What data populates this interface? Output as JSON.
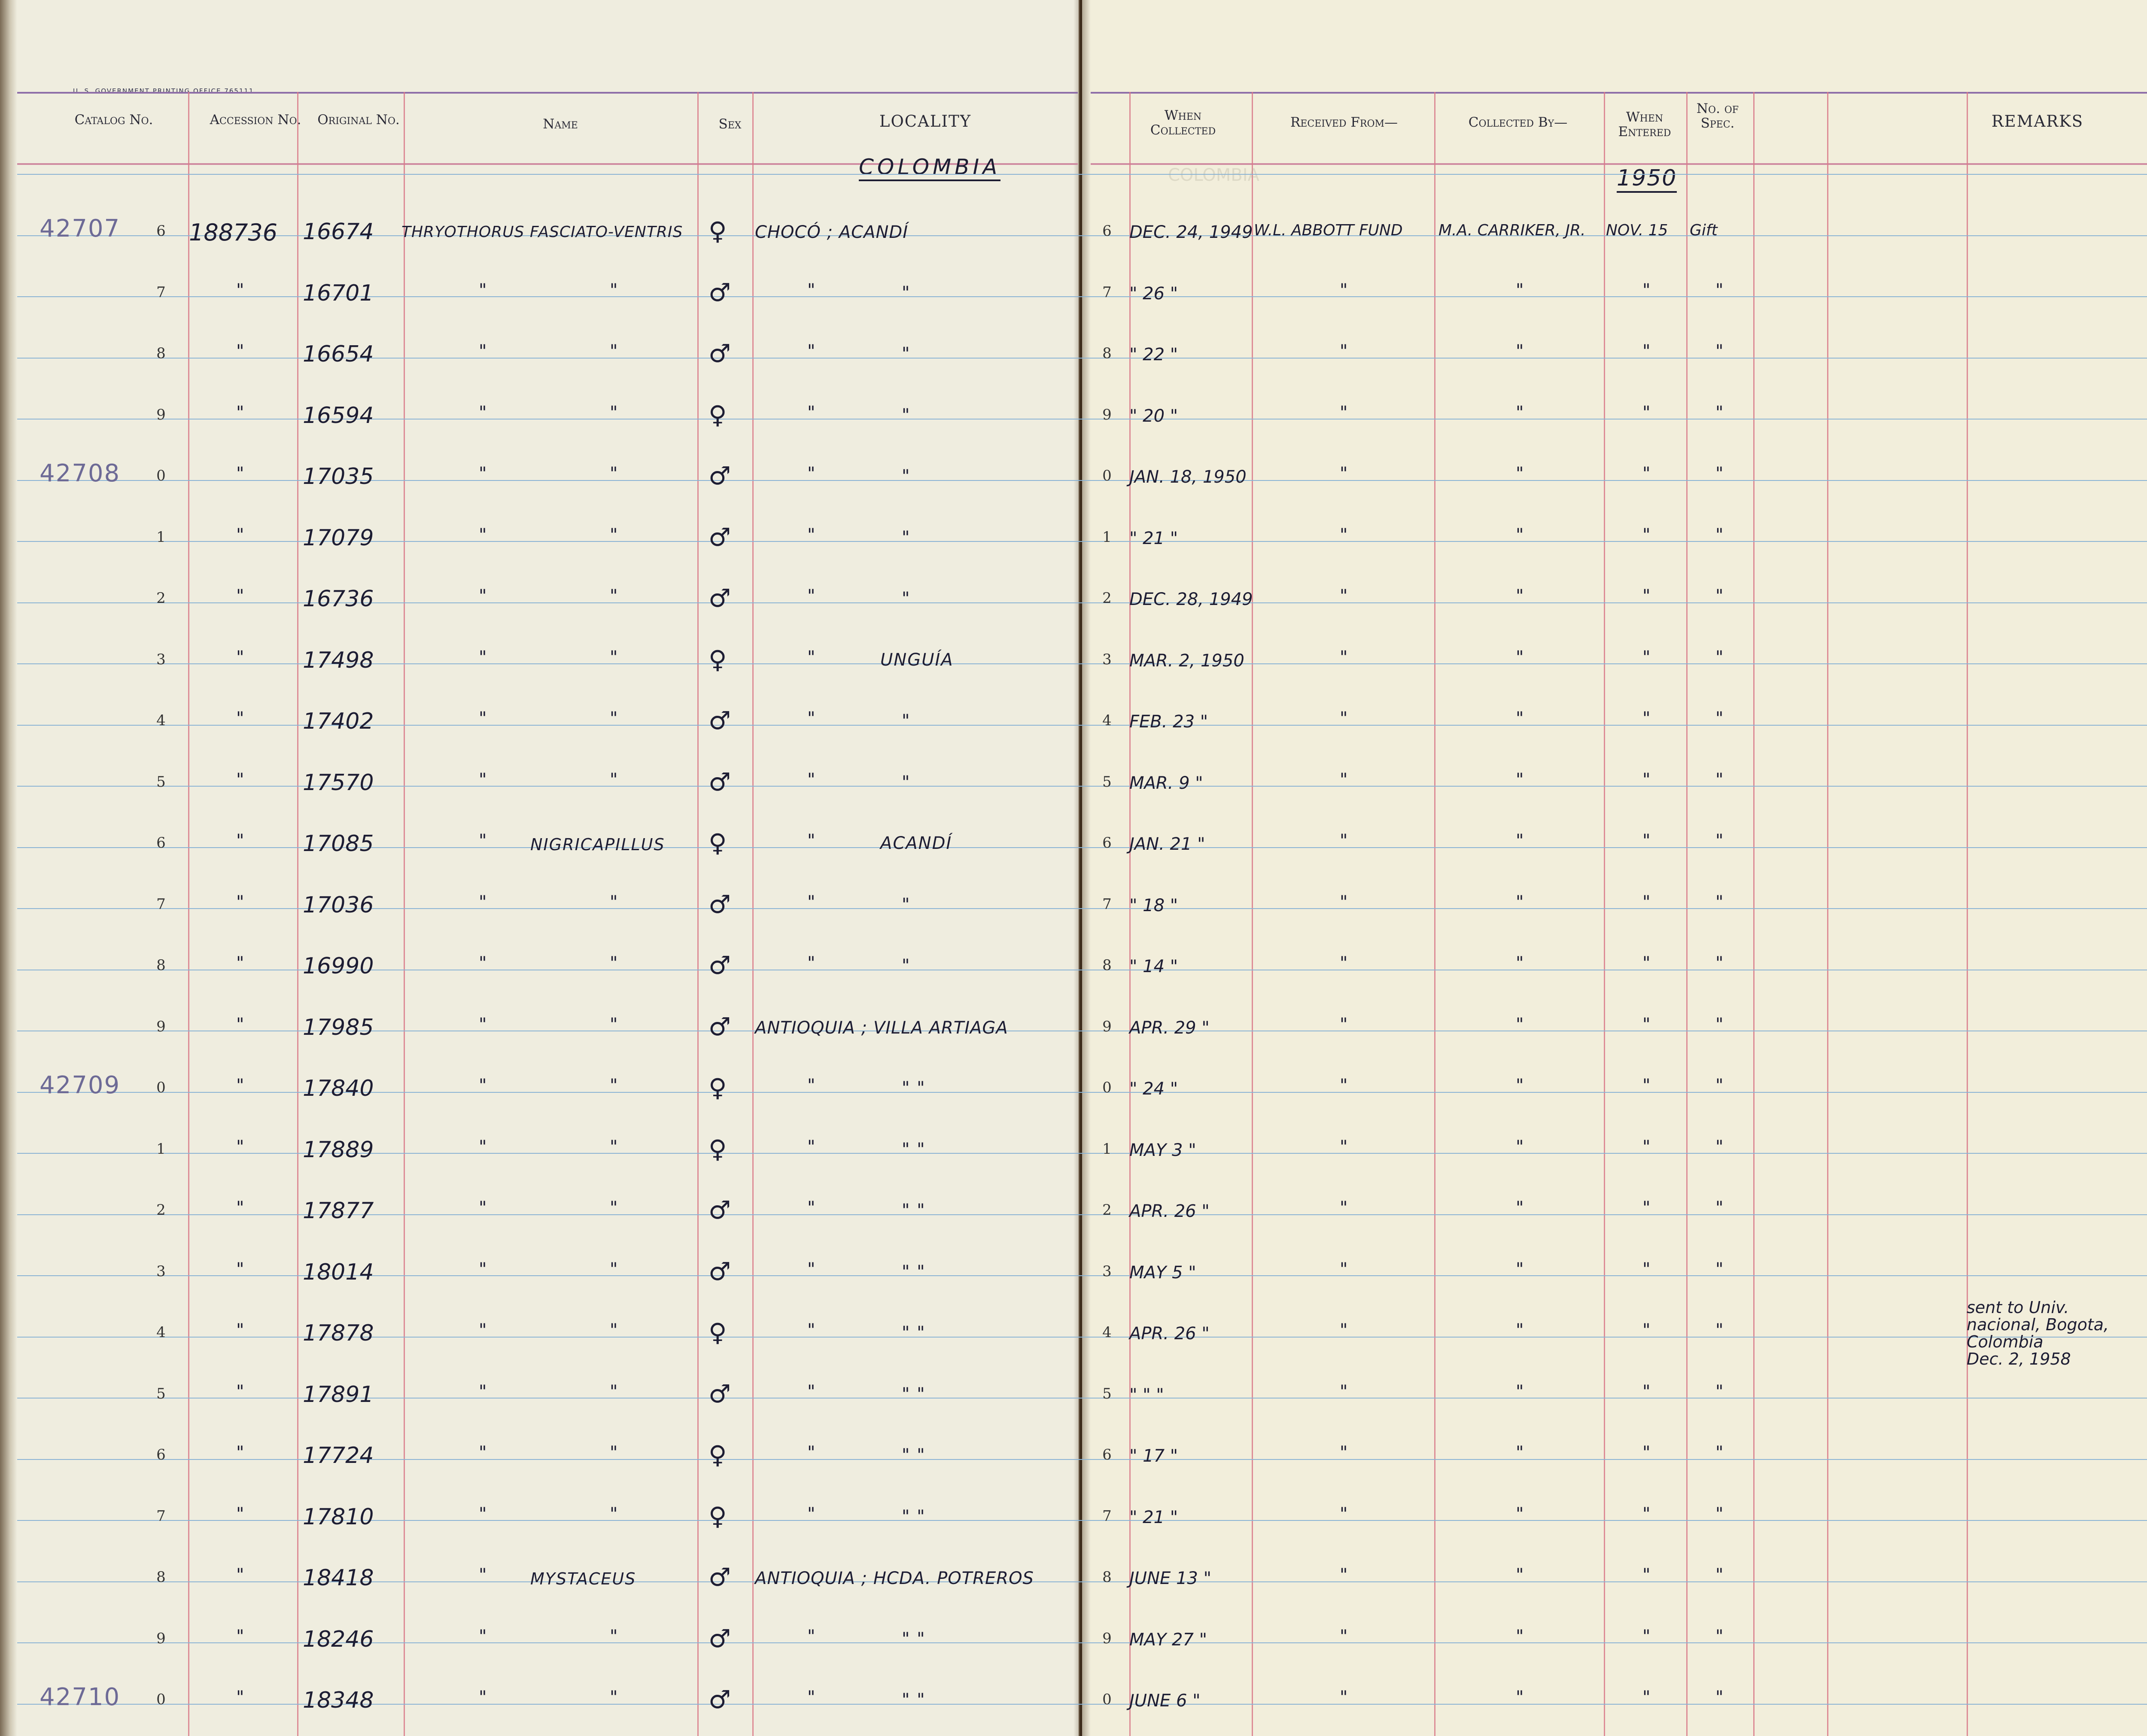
{
  "printer_imprint": "U. S. GOVERNMENT PRINTING OFFICE  765111",
  "headers": {
    "catalog": "Catalog No.",
    "accession": "Accession No.",
    "original": "Original No.",
    "name": "Name",
    "sex": "Sex",
    "locality": "LOCALITY",
    "when_collected": "When Collected",
    "received_from": "Received From—",
    "collected_by": "Collected By—",
    "when_entered": "When Entered",
    "no_spec": "No. of Spec.",
    "remarks": "REMARKS"
  },
  "country_heading": "COLOMBIA",
  "year_heading": "1950",
  "catalog_prefixes": [
    {
      "row": 0,
      "text": "42707"
    },
    {
      "row": 4,
      "text": "42708"
    },
    {
      "row": 14,
      "text": "42709"
    },
    {
      "row": 24,
      "text": "42710"
    }
  ],
  "rows": [
    {
      "num": "6",
      "accession": "188736",
      "original": "16674",
      "name1": "THRYOTHORUS FASCIATO-VENTRIS",
      "name2": "",
      "sex": "♀",
      "loc1": "CHOCÓ ; ACANDÍ",
      "loc2": "",
      "date": "DEC. 24, 1949",
      "recv": "W.L. ABBOTT FUND",
      "coll": "M.A. CARRIKER, JR.",
      "entered": "NOV. 15",
      "spec": "Gift"
    },
    {
      "num": "7",
      "accession": "\"",
      "original": "16701",
      "name1": "\"",
      "name2": "\"",
      "sex": "♂",
      "loc1": "\"",
      "loc2": "\"",
      "date": "\" 26 \"",
      "recv": "\"",
      "coll": "\"",
      "entered": "\"",
      "spec": "\""
    },
    {
      "num": "8",
      "accession": "\"",
      "original": "16654",
      "name1": "\"",
      "name2": "\"",
      "sex": "♂",
      "loc1": "\"",
      "loc2": "\"",
      "date": "\" 22 \"",
      "recv": "\"",
      "coll": "\"",
      "entered": "\"",
      "spec": "\""
    },
    {
      "num": "9",
      "accession": "\"",
      "original": "16594",
      "name1": "\"",
      "name2": "\"",
      "sex": "♀",
      "loc1": "\"",
      "loc2": "\"",
      "date": "\" 20 \"",
      "recv": "\"",
      "coll": "\"",
      "entered": "\"",
      "spec": "\""
    },
    {
      "num": "0",
      "accession": "\"",
      "original": "17035",
      "name1": "\"",
      "name2": "\"",
      "sex": "♂",
      "loc1": "\"",
      "loc2": "\"",
      "date": "JAN. 18, 1950",
      "recv": "\"",
      "coll": "\"",
      "entered": "\"",
      "spec": "\""
    },
    {
      "num": "1",
      "accession": "\"",
      "original": "17079",
      "name1": "\"",
      "name2": "\"",
      "sex": "♂",
      "loc1": "\"",
      "loc2": "\"",
      "date": "\" 21 \"",
      "recv": "\"",
      "coll": "\"",
      "entered": "\"",
      "spec": "\""
    },
    {
      "num": "2",
      "accession": "\"",
      "original": "16736",
      "name1": "\"",
      "name2": "\"",
      "sex": "♂",
      "loc1": "\"",
      "loc2": "\"",
      "date": "DEC. 28, 1949",
      "recv": "\"",
      "coll": "\"",
      "entered": "\"",
      "spec": "\""
    },
    {
      "num": "3",
      "accession": "\"",
      "original": "17498",
      "name1": "\"",
      "name2": "\"",
      "sex": "♀",
      "loc1": "\"",
      "loc2": "UNGUÍA",
      "date": "MAR. 2, 1950",
      "recv": "\"",
      "coll": "\"",
      "entered": "\"",
      "spec": "\""
    },
    {
      "num": "4",
      "accession": "\"",
      "original": "17402",
      "name1": "\"",
      "name2": "\"",
      "sex": "♂",
      "loc1": "\"",
      "loc2": "\"",
      "date": "FEB. 23 \"",
      "recv": "\"",
      "coll": "\"",
      "entered": "\"",
      "spec": "\""
    },
    {
      "num": "5",
      "accession": "\"",
      "original": "17570",
      "name1": "\"",
      "name2": "\"",
      "sex": "♂",
      "loc1": "\"",
      "loc2": "\"",
      "date": "MAR. 9 \"",
      "recv": "\"",
      "coll": "\"",
      "entered": "\"",
      "spec": "\""
    },
    {
      "num": "6",
      "accession": "\"",
      "original": "17085",
      "name1": "\"",
      "name2": "NIGRICAPILLUS",
      "sex": "♀",
      "loc1": "\"",
      "loc2": "ACANDÍ",
      "date": "JAN. 21 \"",
      "recv": "\"",
      "coll": "\"",
      "entered": "\"",
      "spec": "\""
    },
    {
      "num": "7",
      "accession": "\"",
      "original": "17036",
      "name1": "\"",
      "name2": "\"",
      "sex": "♂",
      "loc1": "\"",
      "loc2": "\"",
      "date": "\" 18 \"",
      "recv": "\"",
      "coll": "\"",
      "entered": "\"",
      "spec": "\""
    },
    {
      "num": "8",
      "accession": "\"",
      "original": "16990",
      "name1": "\"",
      "name2": "\"",
      "sex": "♂",
      "loc1": "\"",
      "loc2": "\"",
      "date": "\" 14 \"",
      "recv": "\"",
      "coll": "\"",
      "entered": "\"",
      "spec": "\""
    },
    {
      "num": "9",
      "accession": "\"",
      "original": "17985",
      "name1": "\"",
      "name2": "\"",
      "sex": "♂",
      "loc1": "ANTIOQUIA ; VILLA ARTIAGA",
      "loc2": "",
      "date": "APR. 29 \"",
      "recv": "\"",
      "coll": "\"",
      "entered": "\"",
      "spec": "\""
    },
    {
      "num": "0",
      "accession": "\"",
      "original": "17840",
      "name1": "\"",
      "name2": "\"",
      "sex": "♀",
      "loc1": "\"",
      "loc2": "\"  \"",
      "date": "\" 24 \"",
      "recv": "\"",
      "coll": "\"",
      "entered": "\"",
      "spec": "\""
    },
    {
      "num": "1",
      "accession": "\"",
      "original": "17889",
      "name1": "\"",
      "name2": "\"",
      "sex": "♀",
      "loc1": "\"",
      "loc2": "\"  \"",
      "date": "MAY 3 \"",
      "recv": "\"",
      "coll": "\"",
      "entered": "\"",
      "spec": "\""
    },
    {
      "num": "2",
      "accession": "\"",
      "original": "17877",
      "name1": "\"",
      "name2": "\"",
      "sex": "♂",
      "loc1": "\"",
      "loc2": "\"  \"",
      "date": "APR. 26 \"",
      "recv": "\"",
      "coll": "\"",
      "entered": "\"",
      "spec": "\""
    },
    {
      "num": "3",
      "accession": "\"",
      "original": "18014",
      "name1": "\"",
      "name2": "\"",
      "sex": "♂",
      "loc1": "\"",
      "loc2": "\"  \"",
      "date": "MAY 5 \"",
      "recv": "\"",
      "coll": "\"",
      "entered": "\"",
      "spec": "\""
    },
    {
      "num": "4",
      "accession": "\"",
      "original": "17878",
      "name1": "\"",
      "name2": "\"",
      "sex": "♀",
      "loc1": "\"",
      "loc2": "\"  \"",
      "date": "APR. 26 \"",
      "recv": "\"",
      "coll": "\"",
      "entered": "\"",
      "spec": "\""
    },
    {
      "num": "5",
      "accession": "\"",
      "original": "17891",
      "name1": "\"",
      "name2": "\"",
      "sex": "♂",
      "loc1": "\"",
      "loc2": "\"  \"",
      "date": "\" \" \"",
      "recv": "\"",
      "coll": "\"",
      "entered": "\"",
      "spec": "\""
    },
    {
      "num": "6",
      "accession": "\"",
      "original": "17724",
      "name1": "\"",
      "name2": "\"",
      "sex": "♀",
      "loc1": "\"",
      "loc2": "\"  \"",
      "date": "\" 17 \"",
      "recv": "\"",
      "coll": "\"",
      "entered": "\"",
      "spec": "\""
    },
    {
      "num": "7",
      "accession": "\"",
      "original": "17810",
      "name1": "\"",
      "name2": "\"",
      "sex": "♀",
      "loc1": "\"",
      "loc2": "\"  \"",
      "date": "\" 21 \"",
      "recv": "\"",
      "coll": "\"",
      "entered": "\"",
      "spec": "\""
    },
    {
      "num": "8",
      "accession": "\"",
      "original": "18418",
      "name1": "\"",
      "name2": "MYSTACEUS",
      "sex": "♂",
      "loc1": "ANTIOQUIA ; HCDA. POTREROS",
      "loc2": "",
      "date": "JUNE 13 \"",
      "recv": "\"",
      "coll": "\"",
      "entered": "\"",
      "spec": "\""
    },
    {
      "num": "9",
      "accession": "\"",
      "original": "18246",
      "name1": "\"",
      "name2": "\"",
      "sex": "♂",
      "loc1": "\"",
      "loc2": "\"  \"",
      "date": "MAY 27 \"",
      "recv": "\"",
      "coll": "\"",
      "entered": "\"",
      "spec": "\""
    },
    {
      "num": "0",
      "accession": "\"",
      "original": "18348",
      "name1": "\"",
      "name2": "\"",
      "sex": "♂",
      "loc1": "\"",
      "loc2": "\"  \"",
      "date": "JUNE 6 \"",
      "recv": "\"",
      "coll": "\"",
      "entered": "\"",
      "spec": "\""
    }
  ],
  "remarks": [
    {
      "row": 18,
      "lines": [
        "sent to Univ.",
        "nacional, Bogota,",
        "Colombia",
        "Dec. 2, 1958"
      ]
    }
  ]
}
